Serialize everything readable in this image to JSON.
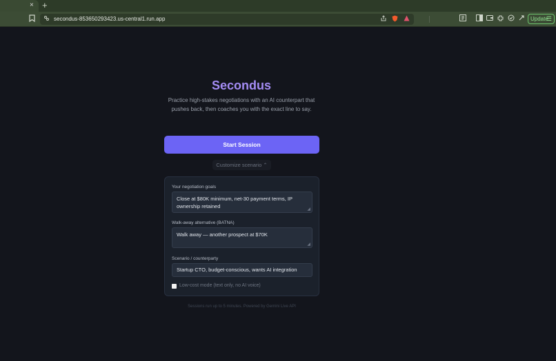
{
  "browser": {
    "tab_close": "×",
    "new_tab": "+",
    "url": "secondus-853650293423.us-central1.run.app",
    "update_label": "Update",
    "update_menu": "☰"
  },
  "app": {
    "title": "Secondus",
    "subtitle": "Practice high-stakes negotiations with an AI counterpart that pushes back, then coaches you with the exact line to say.",
    "start_label": "Start Session",
    "customize_label": "Customize scenario ⌃",
    "goals_label": "Your negotiation goals",
    "goals_value": "Close at $80K minimum, net-30 payment terms, IP ownership retained",
    "batna_label": "Walk-away alternative (BATNA)",
    "batna_value": "Walk away — another prospect at $70K",
    "scenario_label": "Scenario / counterparty",
    "scenario_value": "Startup CTO, budget-conscious, wants AI integration",
    "lowcost_label": "Low-cost mode (text only, no AI voice)",
    "lowcost_checked": false,
    "footer": "Sessions run up to 5 minutes. Powered by Gemini Live API"
  },
  "colors": {
    "accent": "#6c64f5",
    "title": "#a48cf4",
    "background": "#13151c"
  }
}
